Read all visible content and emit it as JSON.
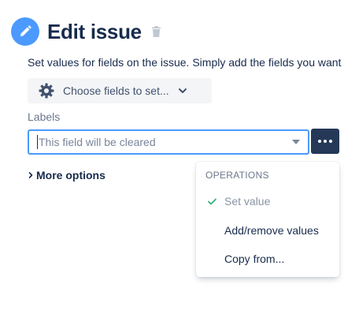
{
  "header": {
    "title": "Edit issue",
    "icon": "edit-pencil-icon",
    "delete_icon": "trash-icon",
    "accent": "#4c9aff"
  },
  "description": "Set values for fields on the issue. Simply add the fields you want",
  "choose_fields": {
    "label": "Choose fields to set...",
    "icon": "gear-icon"
  },
  "labels_field": {
    "label": "Labels",
    "placeholder": "This field will be cleared"
  },
  "more_options": {
    "label": "More options"
  },
  "operations_menu": {
    "heading": "OPERATIONS",
    "items": [
      {
        "label": "Set value",
        "selected": true
      },
      {
        "label": "Add/remove values",
        "selected": false
      },
      {
        "label": "Copy from...",
        "selected": false
      }
    ],
    "check_color": "#36b37e"
  },
  "colors": {
    "text": "#172b4d",
    "focus_border": "#4c9aff",
    "dark_button": "#253858"
  }
}
